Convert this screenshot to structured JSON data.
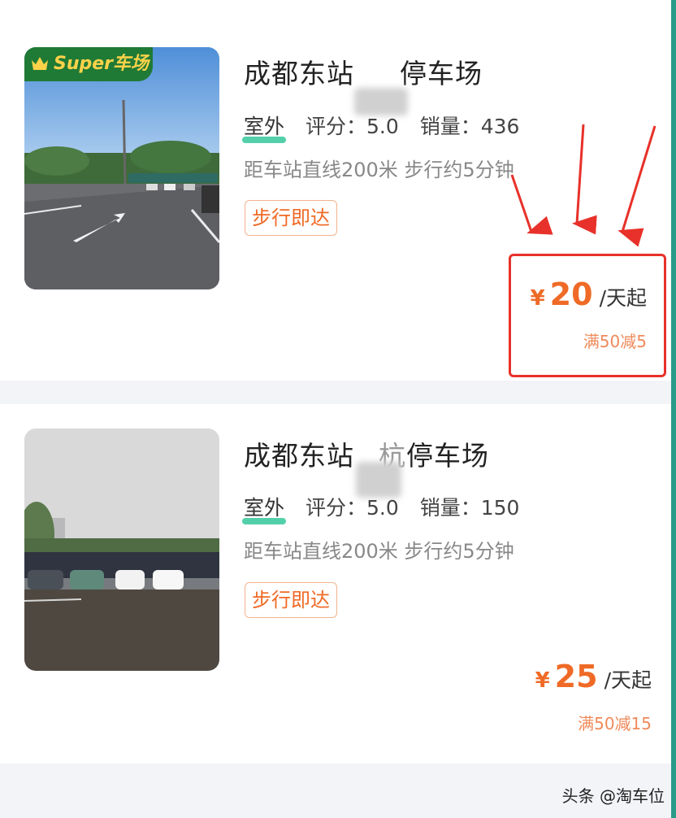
{
  "listings": [
    {
      "badge": "Super车场",
      "title_start": "成都东站",
      "title_end": "停车场",
      "type": "室外",
      "rating_label": "评分：",
      "rating": "5.0",
      "sales_label": "销量：",
      "sales": "436",
      "distance": "距车站直线200米 步行约5分钟",
      "tag": "步行即达",
      "currency": "¥",
      "price": "20",
      "unit": "/天起",
      "discount": "满50减5"
    },
    {
      "title_start": "成都东站",
      "title_end": "停车场",
      "title_partial": "杭",
      "type": "室外",
      "rating_label": "评分：",
      "rating": "5.0",
      "sales_label": "销量：",
      "sales": "150",
      "distance": "距车站直线200米 步行约5分钟",
      "tag": "步行即达",
      "currency": "¥",
      "price": "25",
      "unit": "/天起",
      "discount": "满50减15"
    }
  ],
  "watermark": "头条 @淘车位",
  "colors": {
    "accent": "#ef6a26",
    "highlight": "#e8312a",
    "badge_bg": "#1f7a35",
    "badge_text": "#ffd24a",
    "outdoor_underline": "#35c89a"
  }
}
